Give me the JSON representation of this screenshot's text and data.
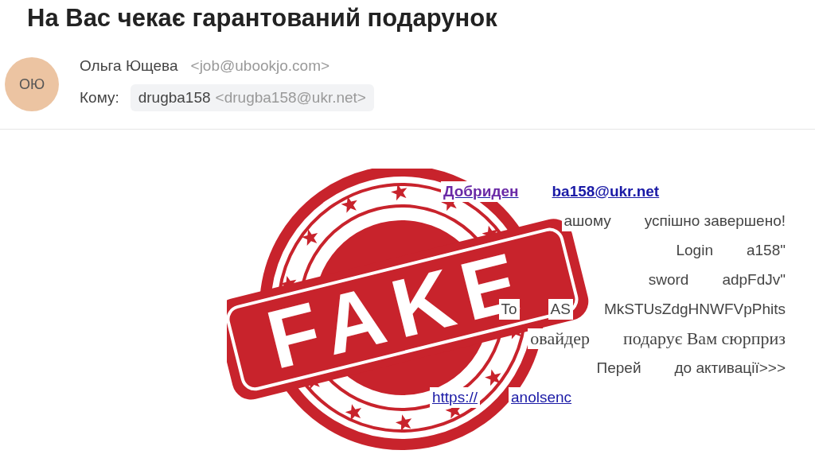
{
  "email": {
    "subject": "На Вас чекає гарантований подарунок",
    "sender": {
      "initials": "ОЮ",
      "name": "Ольга Ющева",
      "address": "<job@ubookjo.com>"
    },
    "recipient": {
      "label": "Кому:",
      "name": "drugba158",
      "address": "<drugba158@ukr.net>"
    },
    "body": [
      {
        "kind": "greeting",
        "segments": [
          "Добриден",
          "ba158@ukr.net"
        ]
      },
      {
        "kind": "text",
        "segments": [
          "ашому",
          "успішно завершено!"
        ]
      },
      {
        "kind": "text",
        "segments": [
          "Login",
          "a158\""
        ]
      },
      {
        "kind": "text",
        "segments": [
          "sword",
          "adpFdJv\""
        ]
      },
      {
        "kind": "text",
        "segments": [
          "To",
          "AS",
          "MkSTUsZdgHNWFVpPhits"
        ]
      },
      {
        "kind": "serif",
        "segments": [
          "овайдер",
          "подарує Вам сюрприз"
        ]
      },
      {
        "kind": "text",
        "segments": [
          "Перей",
          "до активації>>>"
        ]
      },
      {
        "kind": "link",
        "segments": [
          "https://",
          "anolsenc"
        ]
      }
    ]
  },
  "stamp": {
    "text": "FAKE"
  }
}
